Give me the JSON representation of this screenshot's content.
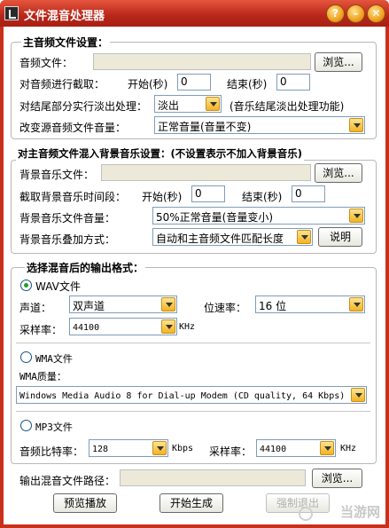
{
  "window": {
    "title": "文件混音处理器",
    "controls": {
      "help": "?",
      "minimize": "–",
      "close": "✕"
    }
  },
  "main_audio": {
    "legend": "主音频文件设置：",
    "file_label": "音频文件：",
    "file_value": "",
    "browse": "浏览...",
    "trim_label": "对音频进行截取：",
    "start_label": "开始(秒)",
    "start_value": "0",
    "end_label": "结束(秒)",
    "end_value": "0",
    "fade_label": "对结尾部分实行淡出处理：",
    "fade_value": "淡出",
    "fade_note": "(音乐结尾淡出处理功能)",
    "volume_label": "改变源音频文件音量：",
    "volume_value": "正常音量(音量不变)"
  },
  "bg_audio": {
    "legend": "对主音频文件混入背景音乐设置：(不设置表示不加入背景音乐)",
    "file_label": "背景音乐文件：",
    "file_value": "",
    "browse": "浏览...",
    "trim_label": "截取背景音乐时间段：",
    "start_label": "开始(秒)",
    "start_value": "0",
    "end_label": "结束(秒)",
    "end_value": "0",
    "volume_label": "背景音乐文件音量：",
    "volume_value": "50%正常音量(音量变小)",
    "mix_label": "背景音乐叠加方式：",
    "mix_value": "自动和主音频文件匹配长度",
    "explain": "说明"
  },
  "output": {
    "legend": "选择混音后的输出格式：",
    "wav": {
      "label": "WAV文件",
      "selected": true,
      "channels_label": "声道：",
      "channels_value": "双声道",
      "bitrate_label": "位速率：",
      "bitrate_value": "16 位",
      "samplerate_label": "采样率：",
      "samplerate_value": "44100",
      "samplerate_unit": "KHz"
    },
    "wma": {
      "label": "WMA文件",
      "selected": false,
      "quality_label": "WMA质量：",
      "quality_value": "Windows Media Audio 8 for Dial-up Modem (CD quality, 64 Kbps)"
    },
    "mp3": {
      "label": "MP3文件",
      "selected": false,
      "bitrate_label": "音频比特率：",
      "bitrate_value": "128",
      "bitrate_unit": "Kbps",
      "samplerate_label": "采样率：",
      "samplerate_value": "44100",
      "samplerate_unit": "KHz"
    }
  },
  "output_path": {
    "label": "输出混音文件路径：",
    "value": "",
    "browse": "浏览..."
  },
  "actions": {
    "preview": "预览播放",
    "start": "开始生成",
    "force_exit": "强制退出"
  },
  "watermark": "当游网",
  "colors": {
    "titlebar": "#c8301c",
    "dropdown_arrow": "#f3b322",
    "radio_dot": "#21a121"
  }
}
